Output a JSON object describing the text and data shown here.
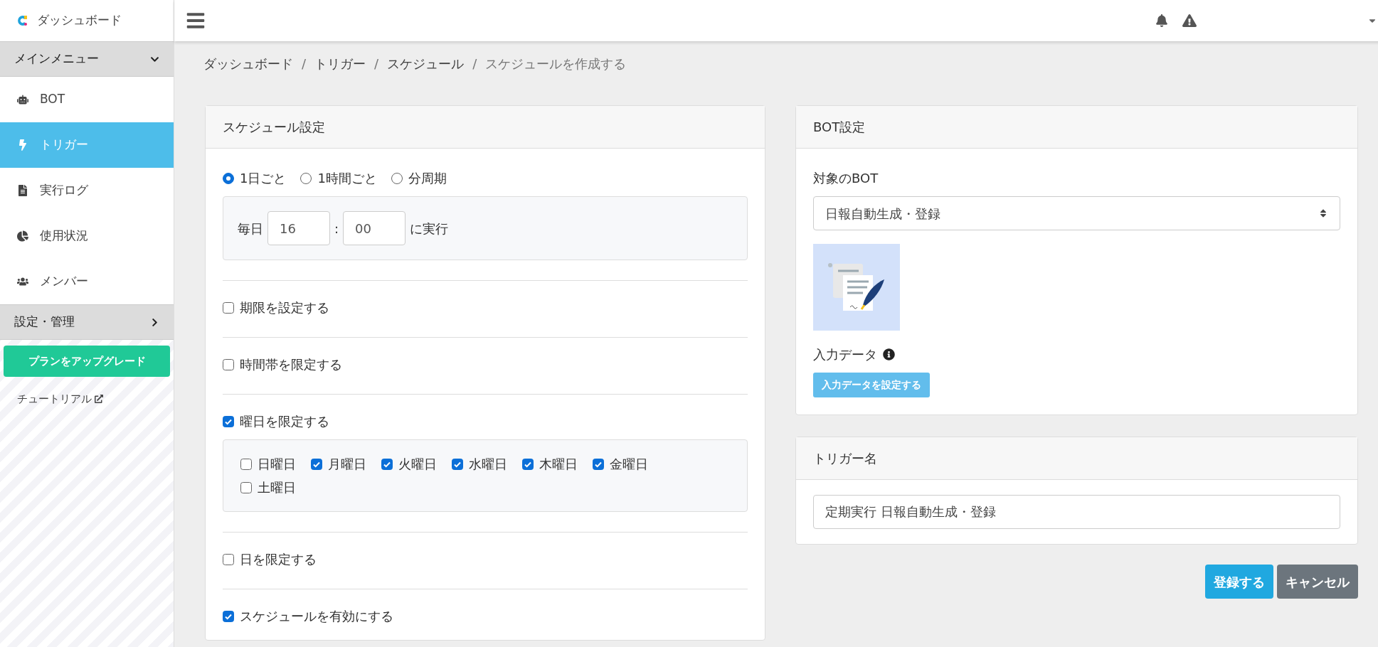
{
  "sidebar": {
    "brand": "ダッシュボード",
    "sections": [
      {
        "title": "メインメニュー",
        "expanded": true,
        "items": [
          {
            "label": "BOT",
            "selected": false
          },
          {
            "label": "トリガー",
            "selected": true
          },
          {
            "label": "実行ログ",
            "selected": false
          },
          {
            "label": "使用状況",
            "selected": false
          },
          {
            "label": "メンバー",
            "selected": false
          }
        ]
      },
      {
        "title": "設定・管理",
        "expanded": false
      }
    ],
    "upgrade_button": "プランをアップグレード",
    "tutorial_link": "チュートリアル"
  },
  "breadcrumb": [
    {
      "label": "ダッシュボード",
      "current": false
    },
    {
      "label": "トリガー",
      "current": false
    },
    {
      "label": "スケジュール",
      "current": false
    },
    {
      "label": "スケジュールを作成する",
      "current": true
    }
  ],
  "breadcrumb_separator": "/",
  "schedule": {
    "title": "スケジュール設定",
    "frequency": [
      {
        "label": "1日ごと",
        "selected": true
      },
      {
        "label": "1時間ごと",
        "selected": false
      },
      {
        "label": "分周期",
        "selected": false
      }
    ],
    "daily": {
      "prefix": "毎日",
      "hour": "16",
      "separator": ":",
      "minute": "00",
      "suffix": "に実行"
    },
    "options": [
      {
        "label": "期限を設定する",
        "checked": false
      },
      {
        "label": "時間帯を限定する",
        "checked": false
      },
      {
        "label": "曜日を限定する",
        "checked": true,
        "days": [
          {
            "label": "日曜日",
            "checked": false
          },
          {
            "label": "月曜日",
            "checked": true
          },
          {
            "label": "火曜日",
            "checked": true
          },
          {
            "label": "水曜日",
            "checked": true
          },
          {
            "label": "木曜日",
            "checked": true
          },
          {
            "label": "金曜日",
            "checked": true
          },
          {
            "label": "土曜日",
            "checked": false
          }
        ]
      },
      {
        "label": "日を限定する",
        "checked": false
      },
      {
        "label": "スケジュールを有効にする",
        "checked": true
      }
    ]
  },
  "bot": {
    "title": "BOT設定",
    "target_label": "対象のBOT",
    "target_value": "日報自動生成・登録",
    "input_label": "入力データ",
    "input_button": "入力データを設定する"
  },
  "trigger_name": {
    "title": "トリガー名",
    "value": "定期実行 日報自動生成・登録"
  },
  "buttons": [
    {
      "label": "登録する",
      "kind": "primary"
    },
    {
      "label": "キャンセル",
      "kind": "secondary"
    }
  ]
}
